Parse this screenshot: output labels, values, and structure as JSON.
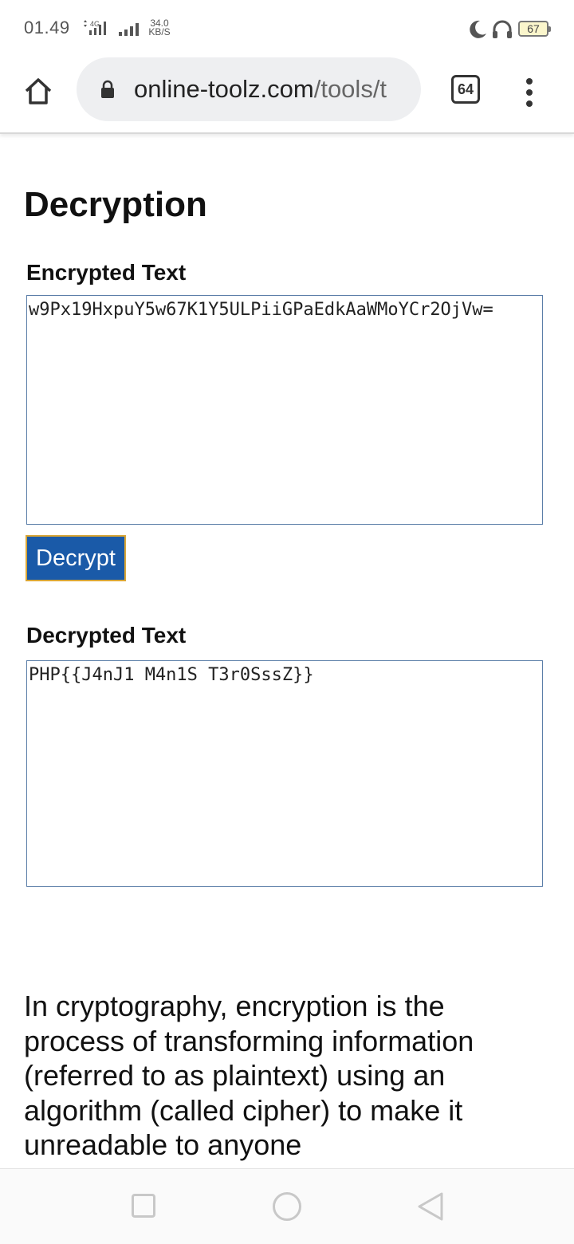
{
  "status_bar": {
    "time": "01.49",
    "network_type": "4G",
    "net_speed_value": "34.0",
    "net_speed_unit": "KB/S",
    "battery_level": "67",
    "icons": [
      "signal-icon",
      "moon-icon",
      "headphone-icon",
      "battery-icon"
    ]
  },
  "browser": {
    "url_domain": "online-toolz.com",
    "url_path": "/tools/t",
    "tab_count": "64",
    "icons": [
      "home-icon",
      "lock-icon",
      "tabs-icon",
      "more-vert-icon"
    ]
  },
  "page": {
    "title": "Decryption",
    "encrypted_label": "Encrypted Text",
    "encrypted_value": "w9Px19HxpuY5w67K1Y5ULPiiGPaEdkAaWMoYCr2OjVw=",
    "decrypt_button": "Decrypt",
    "decrypted_label": "Decrypted Text",
    "decrypted_value": "PHP{{J4nJ1 M4n1S T3r0SssZ}}",
    "description": "In cryptography, encryption is the process of transforming information (referred to as plaintext) using an algorithm (called cipher) to make it unreadable to anyone"
  },
  "colors": {
    "button_bg": "#1a5aa8",
    "button_border": "#d9a636",
    "textbox_border": "#5b7ea8",
    "url_pill_bg": "#eeeff1"
  },
  "nav_bar": {
    "icons": [
      "recents-icon",
      "home-circle-icon",
      "back-icon"
    ]
  }
}
